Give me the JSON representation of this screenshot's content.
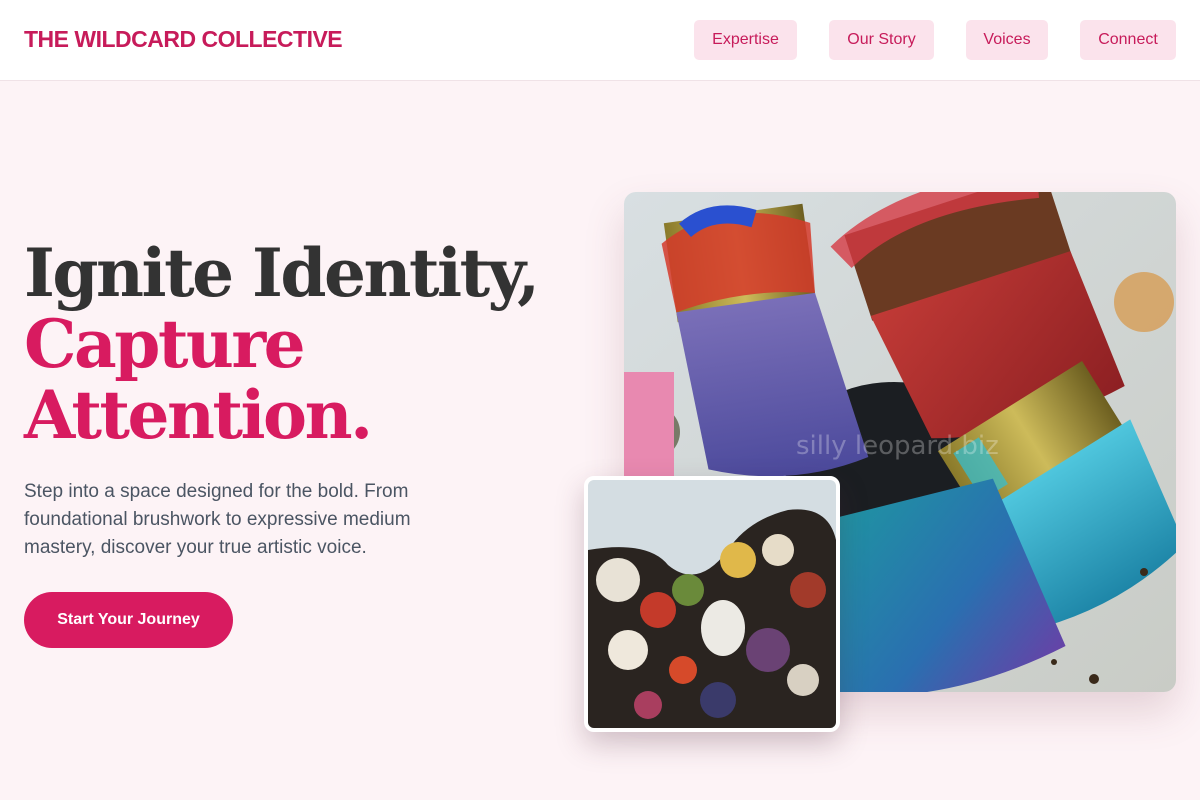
{
  "header": {
    "brand": "THE WILDCARD COLLECTIVE",
    "nav": [
      "Expertise",
      "Our Story",
      "Voices",
      "Connect"
    ]
  },
  "hero": {
    "title_line1": "Ignite Identity,",
    "title_line2": "Capture",
    "title_line3": "Attention.",
    "subtitle": "Step into a space designed for the bold. From foundational brushwork to expressive medium mastery, discover your true artistic voice.",
    "cta_label": "Start Your Journey",
    "watermark": "silly leopard.biz"
  },
  "colors": {
    "accent": "#d81b60",
    "brand": "#c71b5a",
    "nav_bg": "#fbe3ec",
    "page_bg": "#fdf3f6",
    "heading": "#333333"
  },
  "images": {
    "main": "paint-brushes-photo",
    "inset": "paint-palette-photo"
  }
}
